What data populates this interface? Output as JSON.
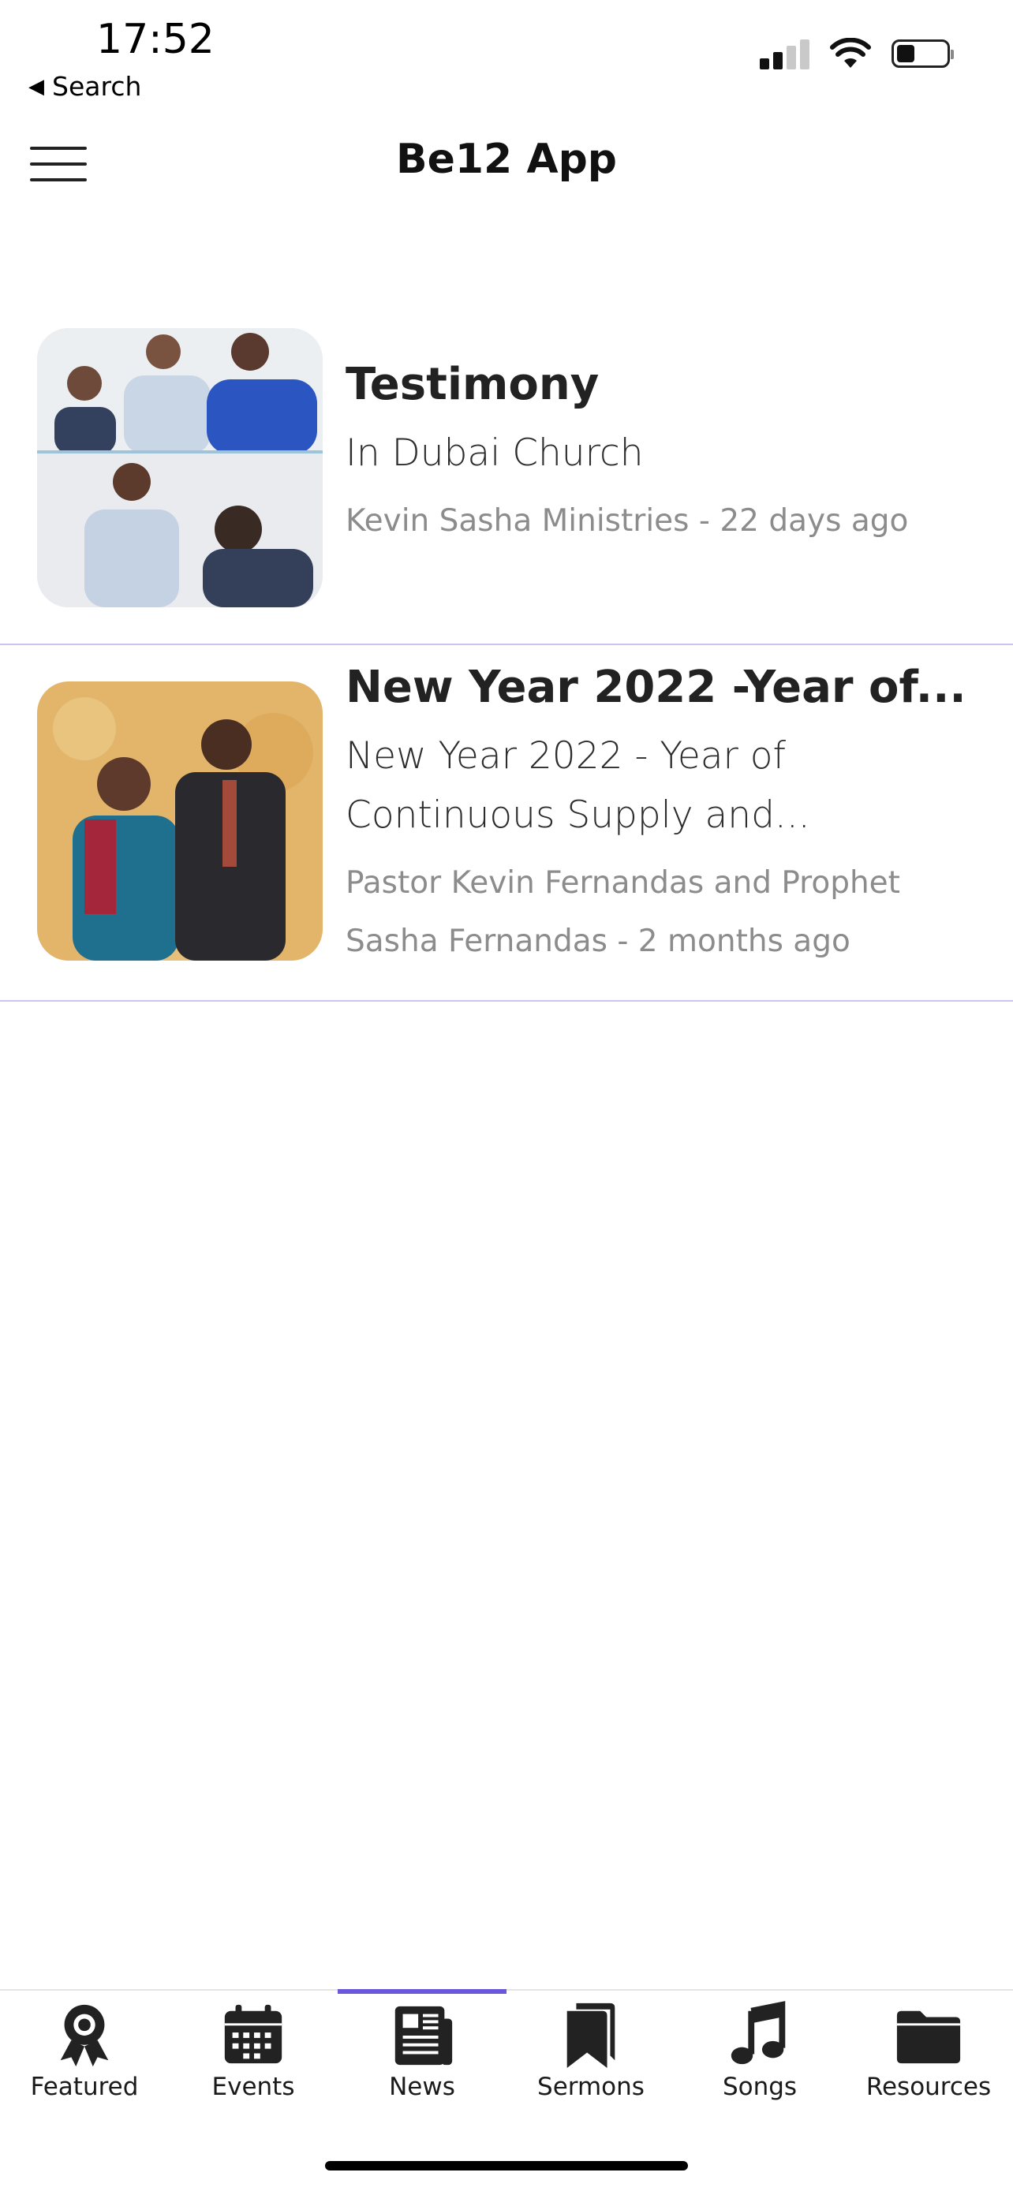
{
  "status_bar": {
    "time": "17:52",
    "back_label": "Search",
    "battery_level": 0.35
  },
  "header": {
    "title": "Be12 App",
    "menu_icon": "hamburger-icon"
  },
  "news": [
    {
      "title": "Testimony",
      "summary": "In Dubai Church",
      "meta": "Kevin Sasha Ministries - 22 days ago"
    },
    {
      "title": "New Year 2022 -Year of...",
      "summary": "New Year 2022 - Year of Continuous Supply and...",
      "meta": "Pastor Kevin Fernandas and Prophet Sasha Fernandas - 2 months ago"
    }
  ],
  "tabs": [
    {
      "label": "Featured",
      "icon": "award-icon"
    },
    {
      "label": "Events",
      "icon": "calendar-icon"
    },
    {
      "label": "News",
      "icon": "newspaper-icon",
      "active": true
    },
    {
      "label": "Sermons",
      "icon": "bookmark-icon"
    },
    {
      "label": "Songs",
      "icon": "music-note-icon"
    },
    {
      "label": "Resources",
      "icon": "folder-icon"
    }
  ],
  "colors": {
    "accent": "#6a57d9",
    "divider": "#c8c6f0",
    "meta_text": "#8c8c8c"
  }
}
